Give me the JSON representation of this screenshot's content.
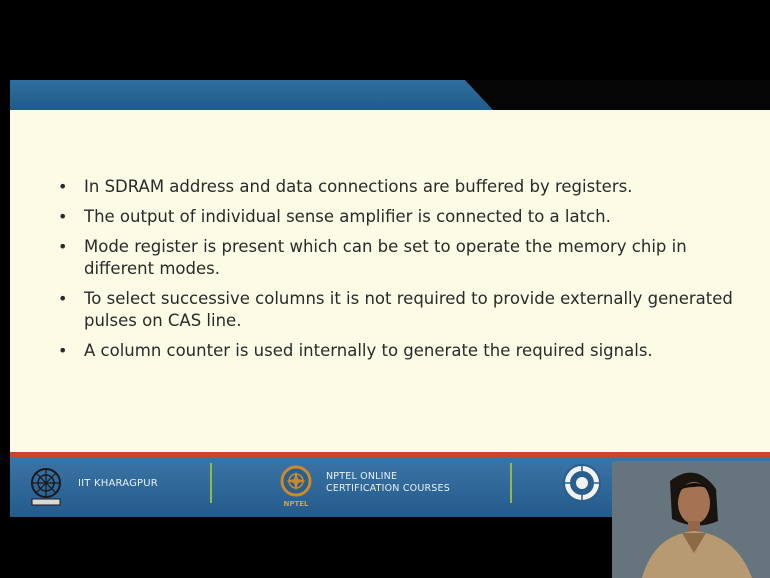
{
  "bullets": [
    "In SDRAM address and data connections are buffered by registers.",
    "The output of individual sense amplifier is connected to a latch.",
    "Mode register is present which can be set to operate the memory chip in different modes.",
    "To select successive columns it is not required to provide externally generated pulses on CAS line.",
    "A column counter is used internally to generate the required signals."
  ],
  "bullet_glyph": "•",
  "footer": {
    "institute": "IIT KHARAGPUR",
    "nptel_line1": "NPTEL ONLINE",
    "nptel_line2": "CERTIFICATION COURSES",
    "nptel_logo_text": "NPTEL"
  },
  "colors": {
    "header_blue": "#2f6e9e",
    "slide_background": "#fbfbe6",
    "accent_red": "#c9452b",
    "footer_blue": "#2e679a",
    "divider_green": "#8fb94a"
  },
  "icons": [
    "iit-kharagpur-logo-icon",
    "nptel-logo-icon",
    "institute-seal-icon"
  ]
}
